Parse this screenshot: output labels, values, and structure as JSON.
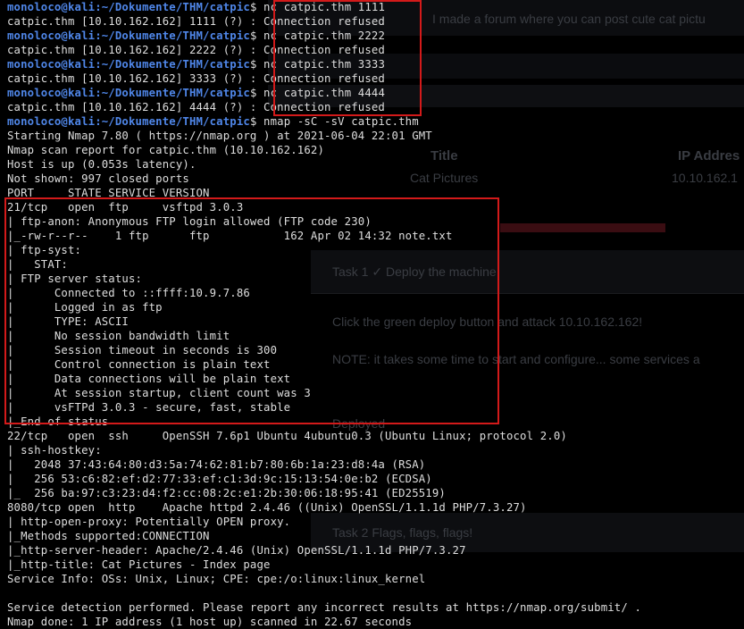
{
  "background_page": {
    "intro_text": "I made a forum where you can post cute cat pictu",
    "table_header_title": "Title",
    "table_header_ip": "IP Addres",
    "table_cell_title": "Cat Pictures",
    "table_cell_ip": "10.10.162.1",
    "task1_title": "Task 1  ✓  Deploy the machine!",
    "task1_body": "Click the green deploy button and attack 10.10.162.162!",
    "task1_note": "NOTE: it takes some time to start and configure... some services a",
    "deployed_label": "Deployed",
    "task2_title": "Task 2   Flags, flags, flags!"
  },
  "prompt": {
    "user_host": "monoloco@kali",
    "path": ":~/Dokumente/THM/catpic",
    "symbol": "$"
  },
  "lines": [
    {
      "type": "prompt",
      "cmd": " nc catpic.thm 1111"
    },
    {
      "type": "out",
      "text": "catpic.thm [10.10.162.162] 1111 (?) : Connection refused"
    },
    {
      "type": "prompt",
      "cmd": " nc catpic.thm 2222"
    },
    {
      "type": "out",
      "text": "catpic.thm [10.10.162.162] 2222 (?) : Connection refused"
    },
    {
      "type": "prompt",
      "cmd": " nc catpic.thm 3333"
    },
    {
      "type": "out",
      "text": "catpic.thm [10.10.162.162] 3333 (?) : Connection refused"
    },
    {
      "type": "prompt",
      "cmd": " nc catpic.thm 4444"
    },
    {
      "type": "out",
      "text": "catpic.thm [10.10.162.162] 4444 (?) : Connection refused"
    },
    {
      "type": "prompt",
      "cmd": " nmap -sC -sV catpic.thm"
    },
    {
      "type": "out",
      "text": "Starting Nmap 7.80 ( https://nmap.org ) at 2021-06-04 22:01 GMT"
    },
    {
      "type": "out",
      "text": "Nmap scan report for catpic.thm (10.10.162.162)"
    },
    {
      "type": "out",
      "text": "Host is up (0.053s latency)."
    },
    {
      "type": "out",
      "text": "Not shown: 997 closed ports"
    },
    {
      "type": "out",
      "text": "PORT     STATE SERVICE VERSION"
    },
    {
      "type": "out",
      "text": "21/tcp   open  ftp     vsftpd 3.0.3"
    },
    {
      "type": "out",
      "text": "| ftp-anon: Anonymous FTP login allowed (FTP code 230)"
    },
    {
      "type": "out",
      "text": "|_-rw-r--r--    1 ftp      ftp           162 Apr 02 14:32 note.txt"
    },
    {
      "type": "out",
      "text": "| ftp-syst:"
    },
    {
      "type": "out",
      "text": "|   STAT:"
    },
    {
      "type": "out",
      "text": "| FTP server status:"
    },
    {
      "type": "out",
      "text": "|      Connected to ::ffff:10.9.7.86"
    },
    {
      "type": "out",
      "text": "|      Logged in as ftp"
    },
    {
      "type": "out",
      "text": "|      TYPE: ASCII"
    },
    {
      "type": "out",
      "text": "|      No session bandwidth limit"
    },
    {
      "type": "out",
      "text": "|      Session timeout in seconds is 300"
    },
    {
      "type": "out",
      "text": "|      Control connection is plain text"
    },
    {
      "type": "out",
      "text": "|      Data connections will be plain text"
    },
    {
      "type": "out",
      "text": "|      At session startup, client count was 3"
    },
    {
      "type": "out",
      "text": "|      vsFTPd 3.0.3 - secure, fast, stable"
    },
    {
      "type": "out",
      "text": "|_End of status"
    },
    {
      "type": "out",
      "text": "22/tcp   open  ssh     OpenSSH 7.6p1 Ubuntu 4ubuntu0.3 (Ubuntu Linux; protocol 2.0)"
    },
    {
      "type": "out",
      "text": "| ssh-hostkey:"
    },
    {
      "type": "out",
      "text": "|   2048 37:43:64:80:d3:5a:74:62:81:b7:80:6b:1a:23:d8:4a (RSA)"
    },
    {
      "type": "out",
      "text": "|   256 53:c6:82:ef:d2:77:33:ef:c1:3d:9c:15:13:54:0e:b2 (ECDSA)"
    },
    {
      "type": "out",
      "text": "|_  256 ba:97:c3:23:d4:f2:cc:08:2c:e1:2b:30:06:18:95:41 (ED25519)"
    },
    {
      "type": "out",
      "text": "8080/tcp open  http    Apache httpd 2.4.46 ((Unix) OpenSSL/1.1.1d PHP/7.3.27)"
    },
    {
      "type": "out",
      "text": "| http-open-proxy: Potentially OPEN proxy."
    },
    {
      "type": "out",
      "text": "|_Methods supported:CONNECTION"
    },
    {
      "type": "out",
      "text": "|_http-server-header: Apache/2.4.46 (Unix) OpenSSL/1.1.1d PHP/7.3.27"
    },
    {
      "type": "out",
      "text": "|_http-title: Cat Pictures - Index page"
    },
    {
      "type": "out",
      "text": "Service Info: OSs: Unix, Linux; CPE: cpe:/o:linux:linux_kernel"
    },
    {
      "type": "out",
      "text": ""
    },
    {
      "type": "out",
      "text": "Service detection performed. Please report any incorrect results at https://nmap.org/submit/ ."
    },
    {
      "type": "out",
      "text": "Nmap done: 1 IP address (1 host up) scanned in 22.67 seconds"
    }
  ],
  "colors": {
    "prompt": "#4f86e8",
    "text": "#dedede",
    "highlight_border": "#d31a1a",
    "background": "#000000"
  }
}
